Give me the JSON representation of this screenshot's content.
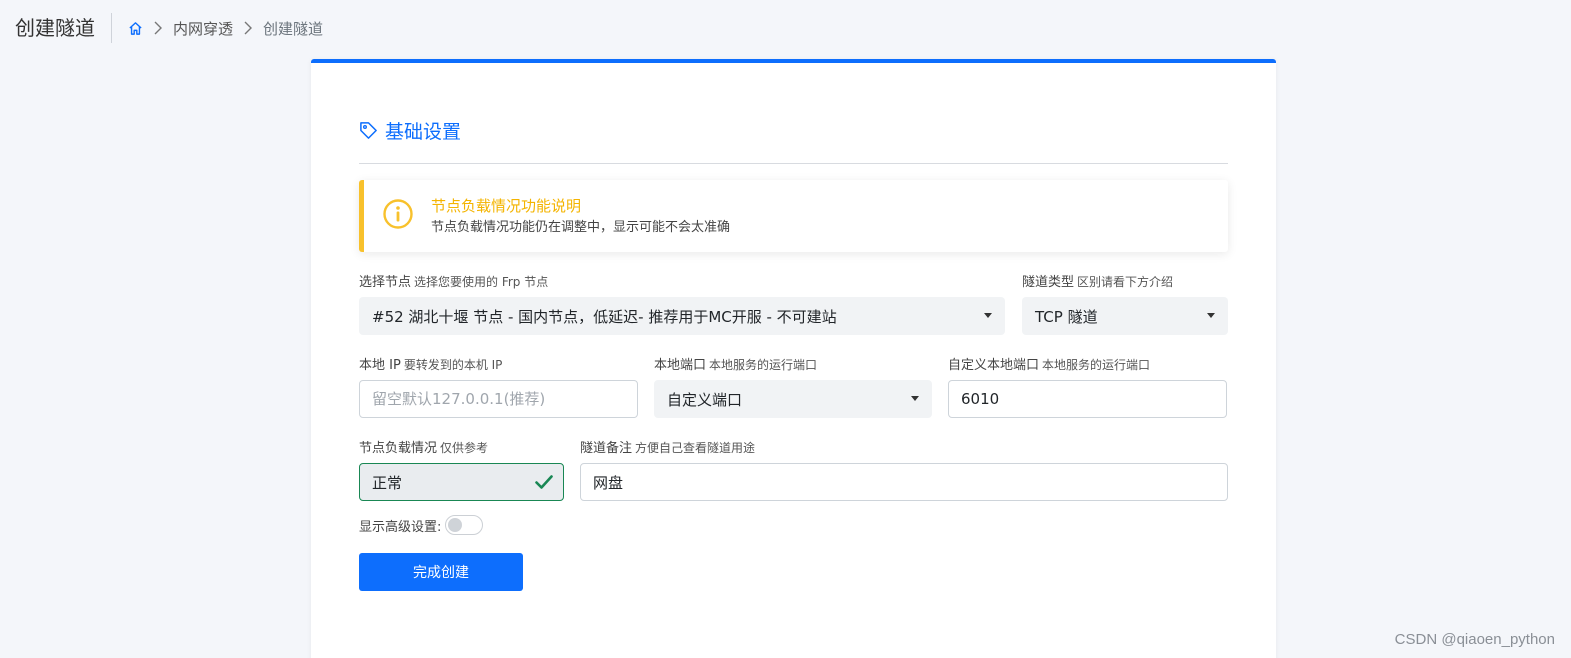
{
  "header": {
    "title": "创建隧道",
    "breadcrumb": [
      "内网穿透",
      "创建隧道"
    ]
  },
  "section": {
    "title": "基础设置"
  },
  "alert": {
    "title": "节点负载情况功能说明",
    "text": "节点负载情况功能仍在调整中，显示可能不会太准确"
  },
  "form": {
    "node": {
      "label": "选择节点",
      "hint": "选择您要使用的 Frp 节点",
      "value": "#52 湖北十堰 节点 - 国内节点，低延迟- 推荐用于MC开服 - 不可建站"
    },
    "tunnel_type": {
      "label": "隧道类型",
      "hint": "区别请看下方介绍",
      "value": "TCP 隧道"
    },
    "local_ip": {
      "label": "本地 IP",
      "hint": "要转发到的本机 IP",
      "value": "",
      "placeholder": "留空默认127.0.0.1(推荐)"
    },
    "local_port": {
      "label": "本地端口",
      "hint": "本地服务的运行端口",
      "value": "自定义端口"
    },
    "custom_port": {
      "label": "自定义本地端口",
      "hint": "本地服务的运行端口",
      "value": "6010"
    },
    "node_load": {
      "label": "节点负载情况",
      "hint": "仅供参考",
      "value": "正常"
    },
    "remark": {
      "label": "隧道备注",
      "hint": "方便自己查看隧道用途",
      "value": "网盘"
    },
    "advanced": {
      "label": "显示高级设置:",
      "enabled": false
    },
    "submit_label": "完成创建"
  },
  "colors": {
    "primary": "#0d6efd",
    "warning": "#f8c12c",
    "success": "#198754"
  },
  "watermark": "CSDN @qiaoen_python"
}
